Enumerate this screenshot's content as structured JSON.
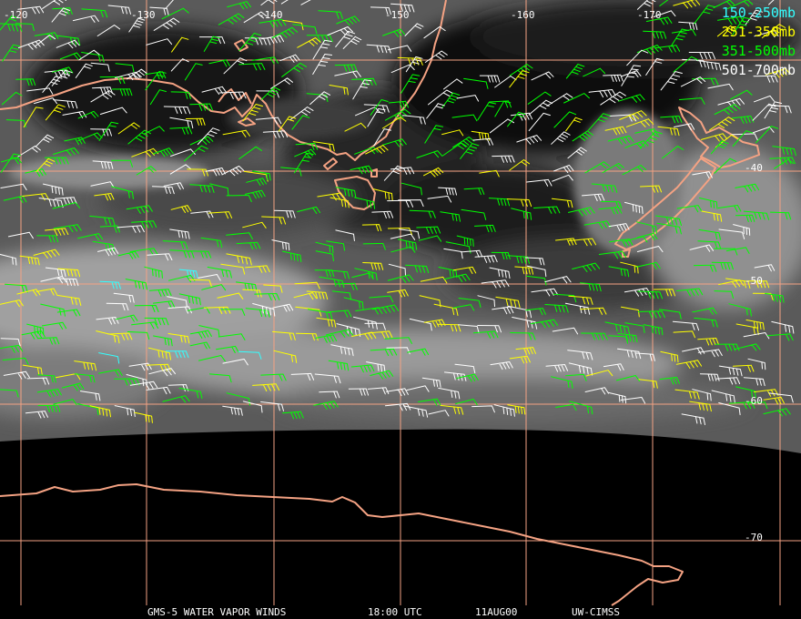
{
  "colors": {
    "grid": "#f4a283",
    "coast": "#f4a283",
    "label": "#ffffff"
  },
  "map": {
    "lon_labels": [
      {
        "text": "-120",
        "lon": -120
      },
      {
        "text": "-130",
        "lon": -130
      },
      {
        "text": "-140",
        "lon": -140
      },
      {
        "text": "-150",
        "lon": -150
      },
      {
        "text": "-160",
        "lon": -160
      },
      {
        "text": "-170",
        "lon": -170
      }
    ],
    "lat_labels": [
      {
        "text": "-40",
        "lat": -40
      },
      {
        "text": "-50",
        "lat": -50
      },
      {
        "text": "-60",
        "lat": -60
      },
      {
        "text": "-70",
        "lat": -70
      }
    ]
  },
  "legend": [
    {
      "label": "150-250mb",
      "color": "#33ffff"
    },
    {
      "label": "251-350mb",
      "color": "#ffff00"
    },
    {
      "label": "351-500mb",
      "color": "#00ff00"
    },
    {
      "label": "501-700mb",
      "color": "#ffffff"
    }
  ],
  "footer": {
    "product": "GMS-5 WATER VAPOR WINDS",
    "time": "18:00 UTC",
    "date": "11AUG00",
    "source": "UW-CIMSS"
  }
}
